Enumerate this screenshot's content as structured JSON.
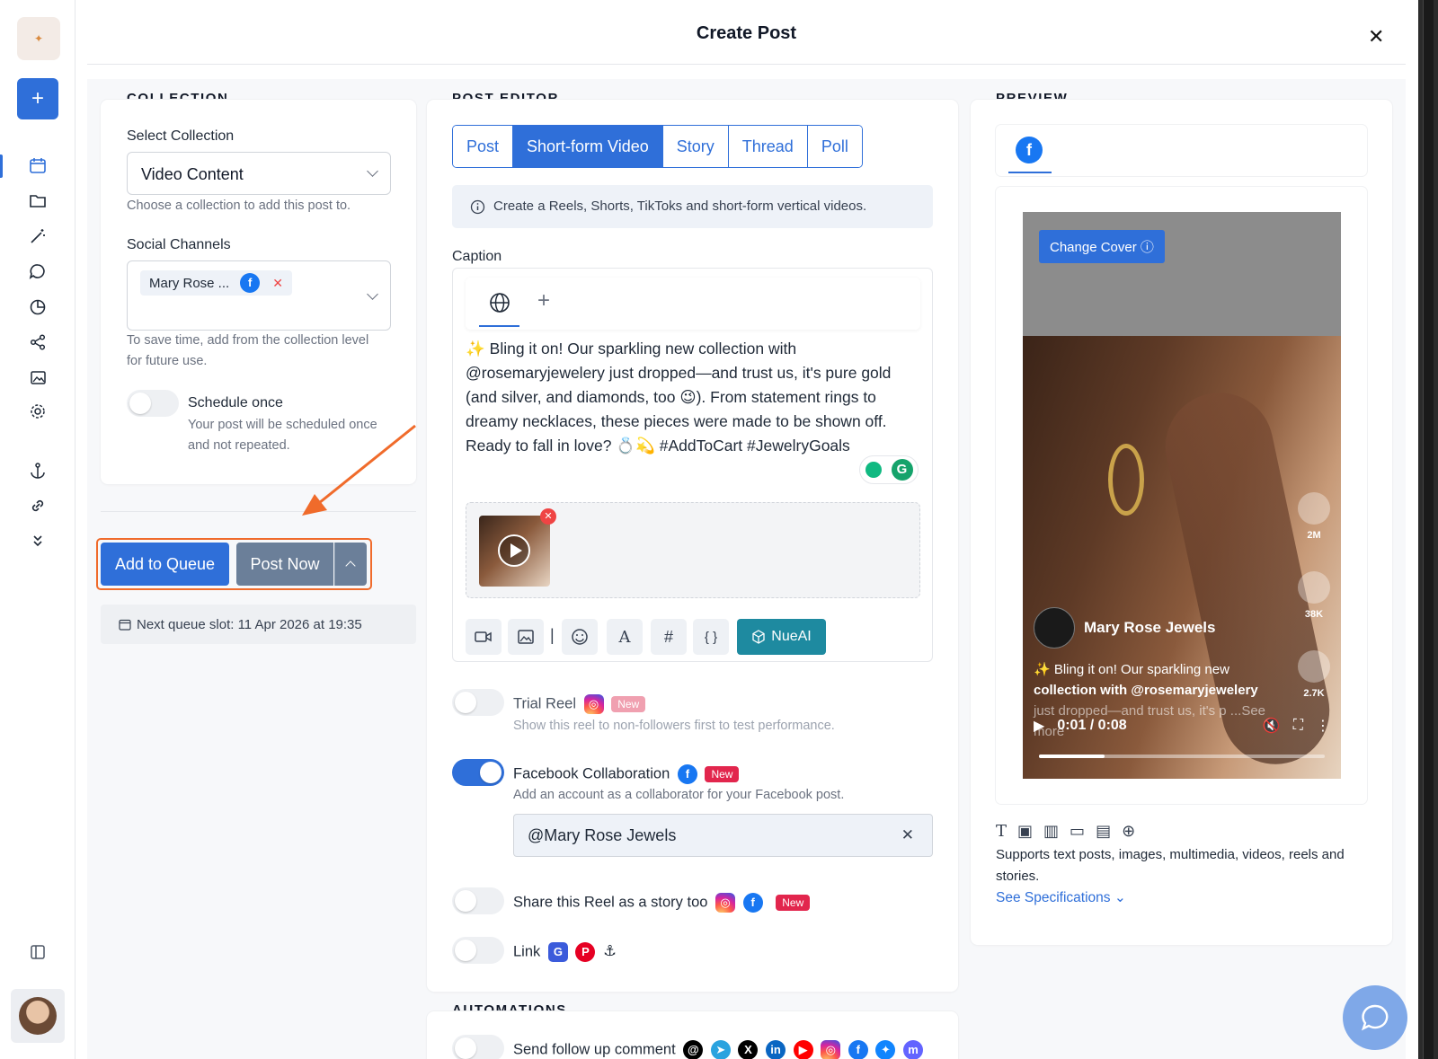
{
  "modal": {
    "title": "Create Post"
  },
  "collection": {
    "heading": "COLLECTION",
    "select_label": "Select Collection",
    "select_value": "Video Content",
    "select_help": "Choose a collection to add this post to.",
    "channels_label": "Social Channels",
    "channel_chip": "Mary Rose ...",
    "channels_help": "To save time, add from the collection level for future use.",
    "schedule_once_label": "Schedule once",
    "schedule_once_help": "Your post will be scheduled once and not repeated."
  },
  "actions": {
    "add_to_queue": "Add to Queue",
    "post_now": "Post Now",
    "next_slot": "Next queue slot: 11 Apr 2026 at 19:35"
  },
  "editor": {
    "heading": "POST EDITOR",
    "tabs": [
      "Post",
      "Short-form Video",
      "Story",
      "Thread",
      "Poll"
    ],
    "active_tab": "Short-form Video",
    "info": "Create a Reels, Shorts, TikToks and short-form vertical videos.",
    "caption_label": "Caption",
    "caption_text": "✨ Bling it on! Our sparkling new collection with @rosemaryjewelery just dropped—and trust us, it's pure gold (and silver, and diamonds, too 😉). From statement rings to dreamy necklaces, these pieces were made to be shown off. Ready to fall in love? 💍💫 #AddToCart #JewelryGoals",
    "nueai_label": "NueAI",
    "tool_hash": "#",
    "tool_braces": "{ }",
    "tool_font": "A",
    "tool_sep": "|"
  },
  "options": {
    "trial_reel": {
      "title": "Trial Reel",
      "badge": "New",
      "help": "Show this reel to non-followers first to test performance.",
      "enabled": false
    },
    "fb_collab": {
      "title": "Facebook Collaboration",
      "badge": "New",
      "help": "Add an account as a collaborator for your Facebook post.",
      "enabled": true,
      "value": "@Mary Rose Jewels"
    },
    "share_story": {
      "title": "Share this Reel as a story too",
      "badge": "New",
      "enabled": false
    },
    "link": {
      "title": "Link",
      "enabled": false
    }
  },
  "automations": {
    "heading": "AUTOMATIONS",
    "follow_up": "Send follow up comment"
  },
  "preview": {
    "heading": "PREVIEW",
    "change_cover": "Change Cover",
    "author": "Mary Rose Jewels",
    "caption_line1": "✨ Bling it on! Our sparkling new",
    "caption_line2": "collection with @rosemaryjewelery",
    "caption_line3": "just dropped—and trust us, it's p ...See",
    "caption_line4": "more",
    "likes": "2M",
    "comments": "38K",
    "shares": "2.7K",
    "time": "0:01 / 0:08",
    "progress": 0.23,
    "supports_text": "Supports text posts, images, multimedia, videos, reels and stories.",
    "spec_link": "See Specifications"
  },
  "colors": {
    "accent": "#2f6fd9",
    "highlight": "#f06b2b",
    "new_badge": "#e2264d",
    "nueai": "#1e8aa0"
  }
}
